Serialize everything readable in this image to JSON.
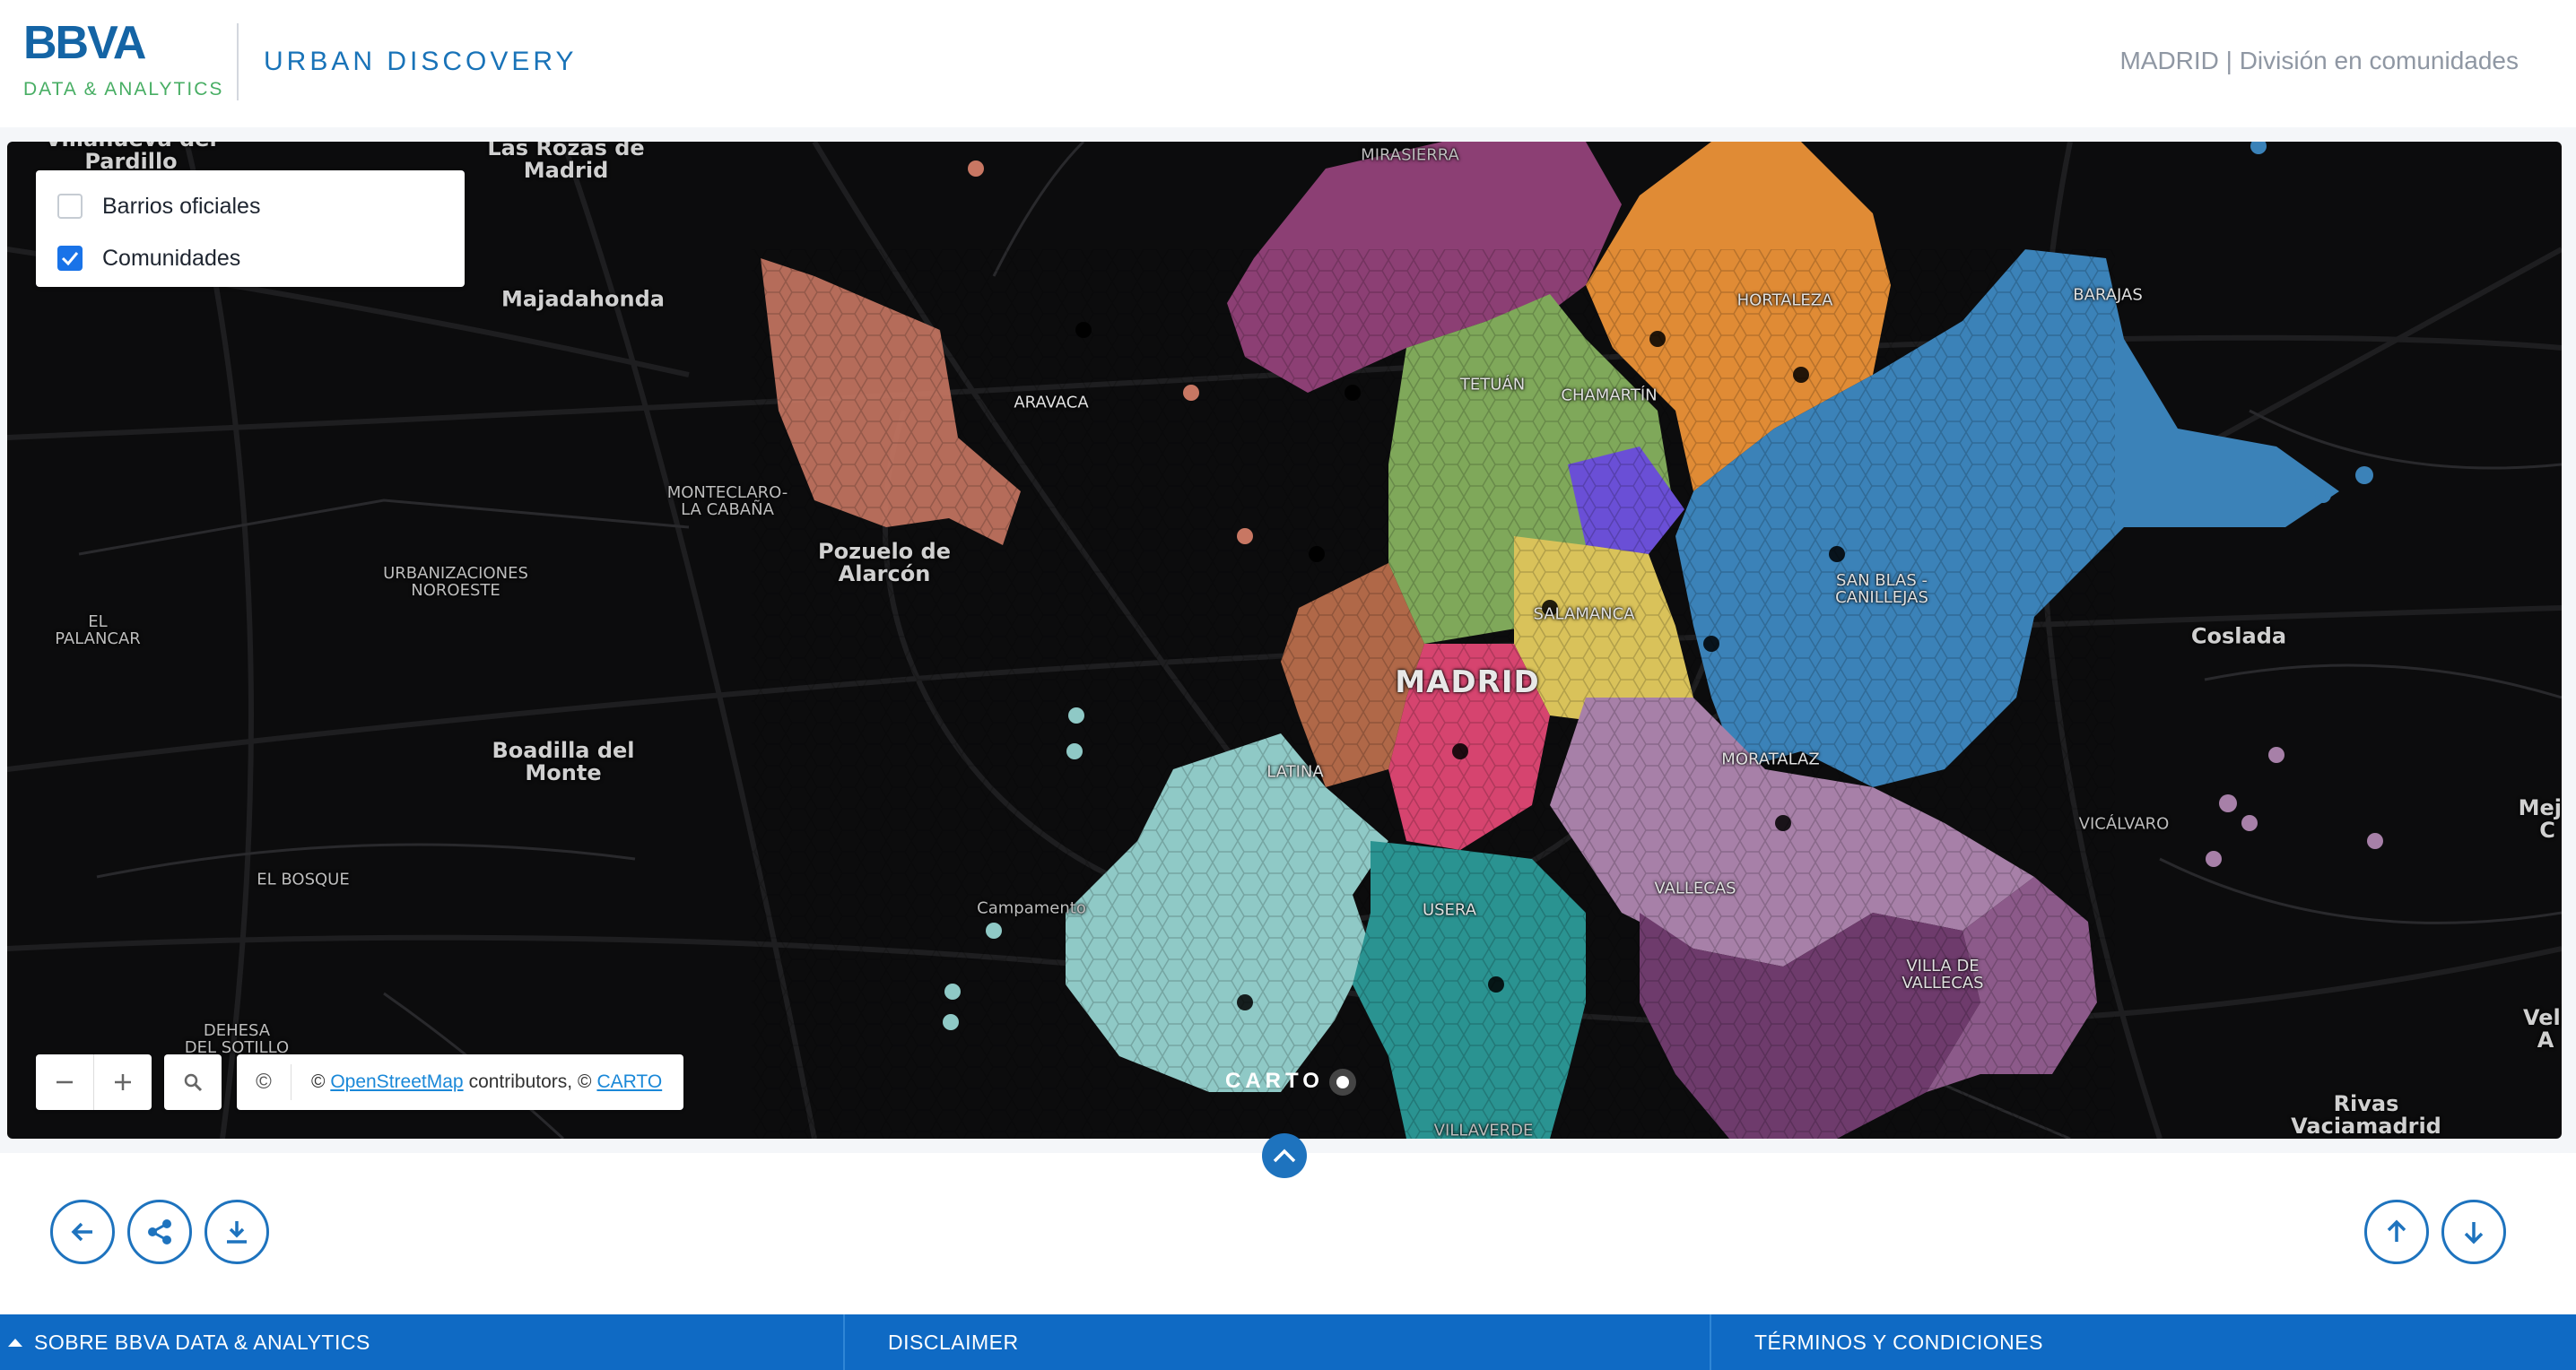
{
  "header": {
    "brand": "BBVA",
    "brand_sub": "DATA & ANALYTICS",
    "app_title": "URBAN DISCOVERY",
    "context": "MADRID | División en comunidades"
  },
  "layers": [
    {
      "label": "Barrios oficiales",
      "checked": false
    },
    {
      "label": "Comunidades",
      "checked": true
    }
  ],
  "map_labels": {
    "villanueva": "Villanueva del\nPardillo",
    "las_rozas": "Las Rozas de\nMadrid",
    "majadahonda": "Majadahonda",
    "mirasierra": "MIRASIERRA",
    "aravaca": "ARAVACA",
    "montecarlo": "MONTECLARO-\nLA CABAÑA",
    "pozuelo": "Pozuelo de\nAlarcón",
    "urbanizaciones": "URBANIZACIONES\nNOROESTE",
    "el_palancar": "EL\nPALANCAR",
    "boadilla": "Boadilla del\nMonte",
    "el_bosque": "EL BOSQUE",
    "dehesa": "DEHESA\nDEL SOTILLO",
    "campamento": "Campamento",
    "tetuan": "TETUÁN",
    "chamartin": "CHAMARTÍN",
    "hortaleza": "HORTALEZA",
    "barajas": "BARAJAS",
    "salamanca": "SALAMANCA",
    "madrid": "MADRID",
    "san_blas": "SAN BLAS -\nCANILLEJAS",
    "coslada": "Coslada",
    "latina": "LATINA",
    "moratalaz": "MORATALAZ",
    "vicalvaro": "VICÁLVARO",
    "usera": "USERA",
    "vallecas": "VALLECAS",
    "villa_vallecas": "VILLA DE\nVALLECAS",
    "villaverde": "VILLAVERDE",
    "rivas": "Rivas\nVaciamadrid",
    "mejo": "Mejo\nC",
    "velil": "Veli\nA"
  },
  "attribution": {
    "prefix": "©",
    "osm": "OpenStreetMap",
    "middle": "contributors, ©",
    "carto": "CARTO"
  },
  "carto_logo": "CARTO",
  "footer": {
    "about": "SOBRE BBVA DATA & ANALYTICS",
    "disclaimer": "DISCLAIMER",
    "terms": "TÉRMINOS Y CONDICIONES"
  },
  "colors": {
    "accent": "#1e73be",
    "footer_bg": "#0f6ac4",
    "map_bg": "#0c0c0d",
    "brand_green": "#48ae64"
  },
  "community_colors": {
    "northwest": "#c87763",
    "north": "#8c3f74",
    "tetuan": "#7fa85a",
    "hortaleza": "#e08b35",
    "barajas": "#3b82b8",
    "chamberi_violet": "#6a4fd6",
    "salamanca": "#d9c25a",
    "centro": "#d6446f",
    "latina": "#8fc9c6",
    "usera": "#2a9391",
    "moratalaz": "#a780a8",
    "vallecas": "#6e3b6c"
  }
}
